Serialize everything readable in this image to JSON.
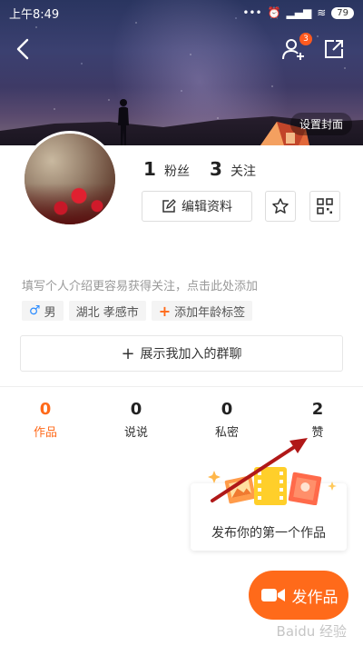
{
  "status_bar": {
    "time": "上午8:49",
    "battery": "79"
  },
  "cover": {
    "set_cover_label": "设置封面"
  },
  "header": {
    "friend_badge": "3"
  },
  "profile": {
    "fans_count": "1",
    "fans_label": "粉丝",
    "follow_count": "3",
    "follow_label": "关注",
    "edit_label": "编辑资料",
    "bio_placeholder": "填写个人介绍更容易获得关注，点击此处添加",
    "tags": {
      "gender": "男",
      "location": "湖北 孝感市",
      "add_age": "添加年龄标签"
    },
    "group_label": "展示我加入的群聊"
  },
  "tabs": [
    {
      "count": "0",
      "label": "作品"
    },
    {
      "count": "0",
      "label": "说说"
    },
    {
      "count": "0",
      "label": "私密"
    },
    {
      "count": "2",
      "label": "赞"
    }
  ],
  "promo": {
    "text": "发布你的第一个作品"
  },
  "publish": {
    "label": "发作品"
  },
  "colors": {
    "accent": "#ff6a1a",
    "arrow": "#b01818"
  }
}
